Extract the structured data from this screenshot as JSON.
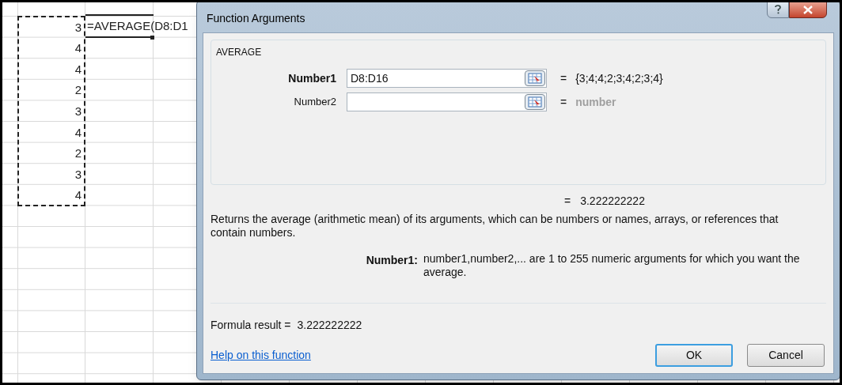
{
  "spreadsheet": {
    "cells": [
      {
        "value": "3"
      },
      {
        "value": "4"
      },
      {
        "value": "4"
      },
      {
        "value": "2"
      },
      {
        "value": "3"
      },
      {
        "value": "4"
      },
      {
        "value": "2"
      },
      {
        "value": "3"
      },
      {
        "value": "4"
      }
    ],
    "formula": "=AVERAGE(D8:D1"
  },
  "dialog": {
    "title": "Function Arguments",
    "function_name": "AVERAGE",
    "arguments": [
      {
        "label": "Number1",
        "value": "D8:D16",
        "equals": "=",
        "result": "{3;4;4;2;3;4;2;3;4}",
        "active": true,
        "result_hint": false
      },
      {
        "label": "Number2",
        "equals": "=",
        "result": "number",
        "active": false,
        "result_hint": true
      }
    ],
    "total_equals": "=",
    "total_result": "3.222222222",
    "description": "Returns the average (arithmetic mean) of its arguments, which can be numbers or names, arrays, or references that contain numbers.",
    "argument_help": {
      "label": "Number1:",
      "text": "number1,number2,... are 1 to 255 numeric arguments for which you want the average."
    },
    "formula_result_label": "Formula result =",
    "formula_result": "3.222222222",
    "help_link": "Help on this function",
    "buttons": [
      {
        "label": "OK",
        "default": true
      },
      {
        "label": "Cancel",
        "default": false
      }
    ]
  }
}
